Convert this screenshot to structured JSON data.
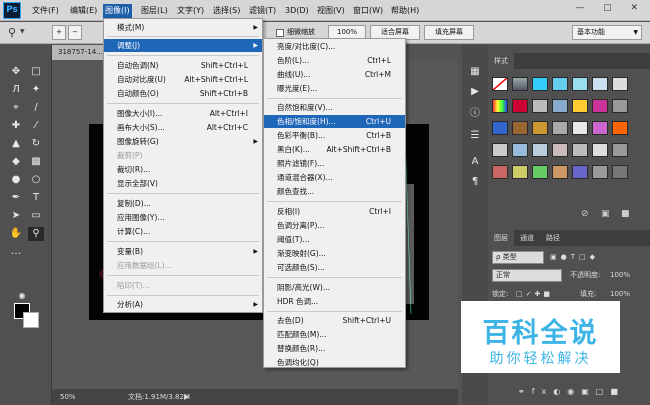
{
  "app": {
    "logo": "Ps",
    "window_controls": "— ▢ ✕"
  },
  "menubar": [
    "文件(F)",
    "编辑(E)",
    "图像(I)",
    "图层(L)",
    "文字(Y)",
    "选择(S)",
    "滤镜(T)",
    "3D(D)",
    "视图(V)",
    "窗口(W)",
    "帮助(H)"
  ],
  "options_bar": {
    "resize_windows": "细微缩放",
    "zoom": "100%",
    "fit_screen": "适合屏幕",
    "fill_screen": "填充屏幕",
    "workspace": "基本功能"
  },
  "document": {
    "tab_title": "318757-14..."
  },
  "status": {
    "zoom": "50%",
    "doc_size": "文档:1.91M/3.82M"
  },
  "image_menu": {
    "items": [
      {
        "label": "模式(M)",
        "submenu": true
      },
      {
        "label": "调整(J)",
        "submenu": true,
        "highlighted": true
      },
      {
        "label": "自动色调(N)",
        "shortcut": "Shift+Ctrl+L"
      },
      {
        "label": "自动对比度(U)",
        "shortcut": "Alt+Shift+Ctrl+L"
      },
      {
        "label": "自动颜色(O)",
        "shortcut": "Shift+Ctrl+B"
      },
      {
        "label": "图像大小(I)...",
        "shortcut": "Alt+Ctrl+I"
      },
      {
        "label": "画布大小(S)...",
        "shortcut": "Alt+Ctrl+C"
      },
      {
        "label": "图像旋转(G)",
        "submenu": true
      },
      {
        "label": "裁剪(P)",
        "disabled": true
      },
      {
        "label": "裁切(R)..."
      },
      {
        "label": "显示全部(V)"
      },
      {
        "label": "复制(D)..."
      },
      {
        "label": "应用图像(Y)..."
      },
      {
        "label": "计算(C)..."
      },
      {
        "label": "变量(B)",
        "submenu": true
      },
      {
        "label": "应用数据组(L)...",
        "disabled": true
      },
      {
        "label": "陷印(T)...",
        "disabled": true
      },
      {
        "label": "分析(A)",
        "submenu": true
      }
    ]
  },
  "adjust_menu": {
    "items": [
      {
        "label": "亮度/对比度(C)..."
      },
      {
        "label": "色阶(L)...",
        "shortcut": "Ctrl+L"
      },
      {
        "label": "曲线(U)...",
        "shortcut": "Ctrl+M"
      },
      {
        "label": "曝光度(E)..."
      },
      {
        "label": "自然饱和度(V)..."
      },
      {
        "label": "色相/饱和度(H)...",
        "shortcut": "Ctrl+U",
        "highlighted": true
      },
      {
        "label": "色彩平衡(B)...",
        "shortcut": "Ctrl+B"
      },
      {
        "label": "黑白(K)...",
        "shortcut": "Alt+Shift+Ctrl+B"
      },
      {
        "label": "照片滤镜(F)..."
      },
      {
        "label": "通道混合器(X)..."
      },
      {
        "label": "颜色查找..."
      },
      {
        "label": "反相(I)",
        "shortcut": "Ctrl+I"
      },
      {
        "label": "色调分离(P)..."
      },
      {
        "label": "阈值(T)..."
      },
      {
        "label": "渐变映射(G)..."
      },
      {
        "label": "可选颜色(S)..."
      },
      {
        "label": "阴影/高光(W)..."
      },
      {
        "label": "HDR 色调..."
      },
      {
        "label": "去色(D)",
        "shortcut": "Shift+Ctrl+U"
      },
      {
        "label": "匹配颜色(M)..."
      },
      {
        "label": "替换颜色(R)..."
      },
      {
        "label": "色调均化(Q)"
      }
    ]
  },
  "styles_panel": {
    "tab": "样式"
  },
  "layers_panel": {
    "tabs": [
      "图层",
      "通道",
      "路径"
    ],
    "filter": "ρ 类型",
    "blend_mode": "正常",
    "opacity_label": "不透明度:",
    "opacity": "100%",
    "lock_label": "锁定:",
    "fill_label": "填充:",
    "fill": "100%"
  },
  "watermark": {
    "title": "百科全说",
    "subtitle": "助你轻松解决"
  },
  "colors": {
    "highlight": "#1e66b8",
    "watermark": "#3cb4e6"
  }
}
